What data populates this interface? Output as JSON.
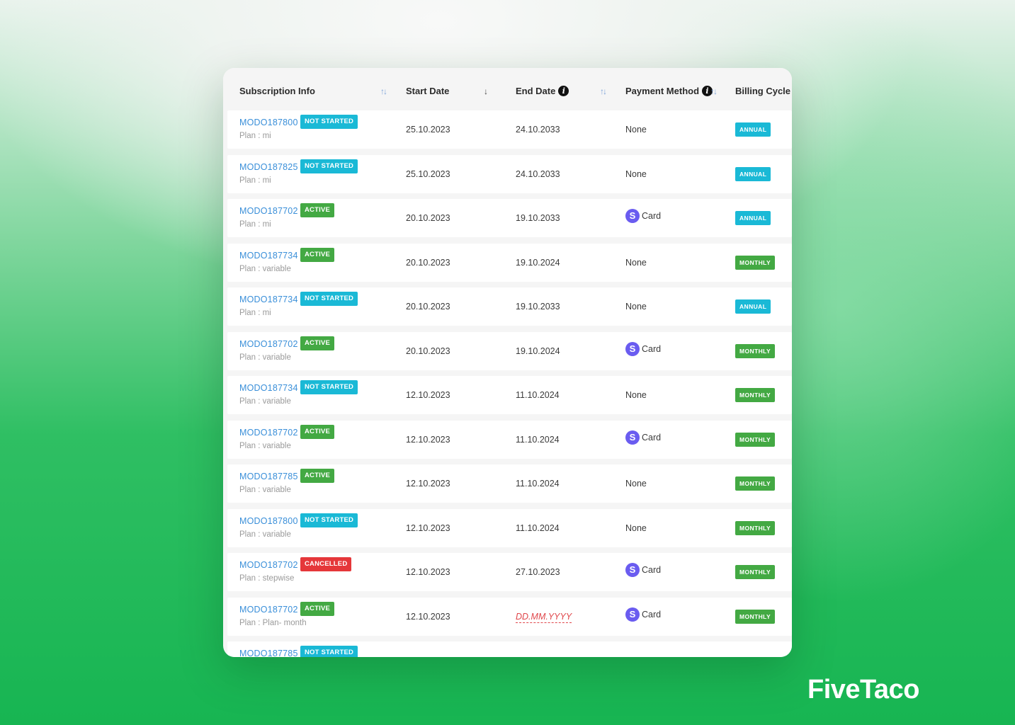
{
  "brand": {
    "logo_text": "FiveTaco"
  },
  "table": {
    "headers": {
      "subscription_info": "Subscription Info",
      "start_date": "Start Date",
      "end_date": "End Date",
      "payment_method": "Payment Method",
      "billing_cycle": "Billing Cycle"
    },
    "sort_icons": {
      "subscription_info": "↑↓",
      "start_date": "↓",
      "end_date": "↑↓",
      "payment_method": "↑↓"
    },
    "info_icon_glyph": "i",
    "stripe_icon_glyph": "S",
    "rows": [
      {
        "id": "MODO187800",
        "status": "NOT STARTED",
        "status_type": "not-started",
        "plan": "Plan : mi",
        "start": "25.10.2023",
        "end": "24.10.2033",
        "end_placeholder": false,
        "payment": "None",
        "payment_icon": false,
        "cycle": "ANNUAL",
        "cycle_type": "annual"
      },
      {
        "id": "MODO187825",
        "status": "NOT STARTED",
        "status_type": "not-started",
        "plan": "Plan : mi",
        "start": "25.10.2023",
        "end": "24.10.2033",
        "end_placeholder": false,
        "payment": "None",
        "payment_icon": false,
        "cycle": "ANNUAL",
        "cycle_type": "annual"
      },
      {
        "id": "MODO187702",
        "status": "ACTIVE",
        "status_type": "active",
        "plan": "Plan : mi",
        "start": "20.10.2023",
        "end": "19.10.2033",
        "end_placeholder": false,
        "payment": "Card",
        "payment_icon": true,
        "cycle": "ANNUAL",
        "cycle_type": "annual"
      },
      {
        "id": "MODO187734",
        "status": "ACTIVE",
        "status_type": "active",
        "plan": "Plan : variable",
        "start": "20.10.2023",
        "end": "19.10.2024",
        "end_placeholder": false,
        "payment": "None",
        "payment_icon": false,
        "cycle": "MONTHLY",
        "cycle_type": "monthly"
      },
      {
        "id": "MODO187734",
        "status": "NOT STARTED",
        "status_type": "not-started",
        "plan": "Plan : mi",
        "start": "20.10.2023",
        "end": "19.10.2033",
        "end_placeholder": false,
        "payment": "None",
        "payment_icon": false,
        "cycle": "ANNUAL",
        "cycle_type": "annual"
      },
      {
        "id": "MODO187702",
        "status": "ACTIVE",
        "status_type": "active",
        "plan": "Plan : variable",
        "start": "20.10.2023",
        "end": "19.10.2024",
        "end_placeholder": false,
        "payment": "Card",
        "payment_icon": true,
        "cycle": "MONTHLY",
        "cycle_type": "monthly"
      },
      {
        "id": "MODO187734",
        "status": "NOT STARTED",
        "status_type": "not-started",
        "plan": "Plan : variable",
        "start": "12.10.2023",
        "end": "11.10.2024",
        "end_placeholder": false,
        "payment": "None",
        "payment_icon": false,
        "cycle": "MONTHLY",
        "cycle_type": "monthly"
      },
      {
        "id": "MODO187702",
        "status": "ACTIVE",
        "status_type": "active",
        "plan": "Plan : variable",
        "start": "12.10.2023",
        "end": "11.10.2024",
        "end_placeholder": false,
        "payment": "Card",
        "payment_icon": true,
        "cycle": "MONTHLY",
        "cycle_type": "monthly"
      },
      {
        "id": "MODO187785",
        "status": "ACTIVE",
        "status_type": "active",
        "plan": "Plan : variable",
        "start": "12.10.2023",
        "end": "11.10.2024",
        "end_placeholder": false,
        "payment": "None",
        "payment_icon": false,
        "cycle": "MONTHLY",
        "cycle_type": "monthly"
      },
      {
        "id": "MODO187800",
        "status": "NOT STARTED",
        "status_type": "not-started",
        "plan": "Plan : variable",
        "start": "12.10.2023",
        "end": "11.10.2024",
        "end_placeholder": false,
        "payment": "None",
        "payment_icon": false,
        "cycle": "MONTHLY",
        "cycle_type": "monthly"
      },
      {
        "id": "MODO187702",
        "status": "CANCELLED",
        "status_type": "cancelled",
        "plan": "Plan : stepwise",
        "start": "12.10.2023",
        "end": "27.10.2023",
        "end_placeholder": false,
        "payment": "Card",
        "payment_icon": true,
        "cycle": "MONTHLY",
        "cycle_type": "monthly"
      },
      {
        "id": "MODO187702",
        "status": "ACTIVE",
        "status_type": "active",
        "plan": "Plan : Plan- month",
        "start": "12.10.2023",
        "end": "DD.MM.YYYY",
        "end_placeholder": true,
        "payment": "Card",
        "payment_icon": true,
        "cycle": "MONTHLY",
        "cycle_type": "monthly"
      },
      {
        "id": "MODO187785",
        "status": "NOT STARTED",
        "status_type": "not-started",
        "plan": "",
        "start": "",
        "end": "",
        "end_placeholder": false,
        "payment": "",
        "payment_icon": false,
        "cycle": "",
        "cycle_type": "monthly"
      }
    ]
  }
}
